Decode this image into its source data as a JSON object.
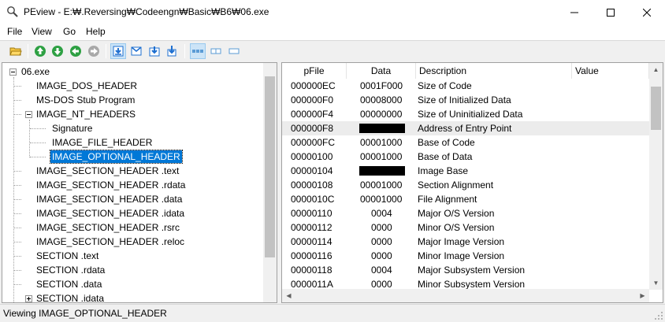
{
  "window": {
    "title": "PEview - E:₩.Reversing₩Codeengn₩Basic₩B6₩06.exe",
    "icon": "magnifier-icon"
  },
  "menu": [
    "File",
    "View",
    "Go",
    "Help"
  ],
  "toolbar": {
    "icons": [
      "open-folder-icon",
      "up-icon",
      "down-icon",
      "back-icon",
      "forward-icon",
      "view-byte-icon",
      "view-word-icon",
      "view-dword-icon",
      "view-address-icon",
      "layout-1-icon",
      "layout-2-icon",
      "layout-3-icon"
    ]
  },
  "tree": {
    "root": "06.exe",
    "items": [
      "IMAGE_DOS_HEADER",
      "MS-DOS Stub Program",
      "IMAGE_NT_HEADERS",
      "Signature",
      "IMAGE_FILE_HEADER",
      "IMAGE_OPTIONAL_HEADER",
      "IMAGE_SECTION_HEADER .text",
      "IMAGE_SECTION_HEADER .rdata",
      "IMAGE_SECTION_HEADER .data",
      "IMAGE_SECTION_HEADER .idata",
      "IMAGE_SECTION_HEADER .rsrc",
      "IMAGE_SECTION_HEADER .reloc",
      "SECTION .text",
      "SECTION .rdata",
      "SECTION .data",
      "SECTION .idata"
    ],
    "selected": "IMAGE_OPTIONAL_HEADER"
  },
  "list": {
    "columns": [
      "pFile",
      "Data",
      "Description",
      "Value"
    ],
    "rows": [
      {
        "pfile": "000000EC",
        "data": "0001F000",
        "desc": "Size of Code"
      },
      {
        "pfile": "000000F0",
        "data": "00008000",
        "desc": "Size of Initialized Data"
      },
      {
        "pfile": "000000F4",
        "data": "00000000",
        "desc": "Size of Uninitialized Data"
      },
      {
        "pfile": "000000F8",
        "data": "",
        "desc": "Address of Entry Point"
      },
      {
        "pfile": "000000FC",
        "data": "00001000",
        "desc": "Base of Code"
      },
      {
        "pfile": "00000100",
        "data": "00001000",
        "desc": "Base of Data"
      },
      {
        "pfile": "00000104",
        "data": "",
        "desc": "Image Base"
      },
      {
        "pfile": "00000108",
        "data": "00001000",
        "desc": "Section Alignment"
      },
      {
        "pfile": "0000010C",
        "data": "00001000",
        "desc": "File Alignment"
      },
      {
        "pfile": "00000110",
        "data": "0004",
        "desc": "Major O/S Version"
      },
      {
        "pfile": "00000112",
        "data": "0000",
        "desc": "Minor O/S Version"
      },
      {
        "pfile": "00000114",
        "data": "0000",
        "desc": "Major Image Version"
      },
      {
        "pfile": "00000116",
        "data": "0000",
        "desc": "Minor Image Version"
      },
      {
        "pfile": "00000118",
        "data": "0004",
        "desc": "Major Subsystem Version"
      },
      {
        "pfile": "0000011A",
        "data": "0000",
        "desc": "Minor Subsystem Version"
      }
    ]
  },
  "status": "Viewing IMAGE_OPTIONAL_HEADER",
  "colors": {
    "selection": "#0078d7",
    "toolbar_pressed": "#cce4f7",
    "arrow_green": "#2ea043",
    "doc_blue": "#1e6fd0"
  }
}
